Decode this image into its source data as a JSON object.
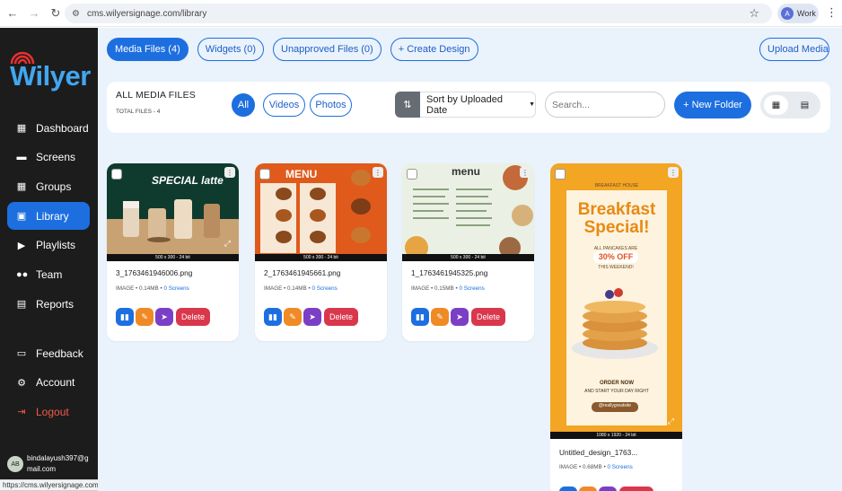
{
  "browser": {
    "url": "cms.wilyersignage.com/library",
    "profile_initial": "A",
    "profile_label": "Work",
    "status_url": "https://cms.wilyersignage.com/library"
  },
  "sidebar": {
    "brand": "Wilyer",
    "items": [
      {
        "label": "Dashboard",
        "icon": "dashboard-icon"
      },
      {
        "label": "Screens",
        "icon": "monitor-icon"
      },
      {
        "label": "Groups",
        "icon": "groups-grid-icon"
      },
      {
        "label": "Library",
        "icon": "library-folder-icon",
        "active": true
      },
      {
        "label": "Playlists",
        "icon": "playlist-icon"
      },
      {
        "label": "Team",
        "icon": "team-icon"
      },
      {
        "label": "Reports",
        "icon": "reports-icon"
      }
    ],
    "bottom_items": [
      {
        "label": "Feedback",
        "icon": "feedback-icon"
      },
      {
        "label": "Account",
        "icon": "gear-icon"
      },
      {
        "label": "Logout",
        "icon": "logout-icon"
      }
    ],
    "user": {
      "initials": "AB",
      "email": "bindalayush397@gmail.com"
    }
  },
  "tabs": {
    "media": "Media Files (4)",
    "widgets": "Widgets (0)",
    "unapproved": "Unapproved Files (0)",
    "create": "+ Create Design",
    "upload": "Upload Media"
  },
  "panel": {
    "title": "ALL MEDIA FILES",
    "total": "TOTAL FILES - 4",
    "filters": {
      "all": "All",
      "videos": "Videos",
      "photos": "Photos"
    },
    "sort_label": "Sort by Uploaded Date",
    "search_placeholder": "Search...",
    "new_folder": "+ New Folder"
  },
  "files": [
    {
      "name": "3_1763461946006.png",
      "type": "IMAGE",
      "size": "0.14MB",
      "screens": "0 Screens",
      "dims": "500 x 300 - 24 bit",
      "thumb_text": "SPECIAL latte"
    },
    {
      "name": "2_1763461945661.png",
      "type": "IMAGE",
      "size": "0.14MB",
      "screens": "0 Screens",
      "dims": "500 x 300 - 24 bit",
      "thumb_text": "MENU"
    },
    {
      "name": "1_1763461945325.png",
      "type": "IMAGE",
      "size": "0.15MB",
      "screens": "0 Screens",
      "dims": "500 x 300 - 24 bit",
      "thumb_text": "menu"
    },
    {
      "name": "Untitled_design_1763...",
      "type": "IMAGE",
      "size": "0.68MB",
      "screens": "0 Screens",
      "dims": "1080 x 1920 - 24 bit",
      "thumb_title": "Breakfast Special!",
      "thumb_badge": "30% OFF",
      "thumb_badge_top": "ALL PANCAKES ARE",
      "thumb_badge_bottom": "THIS WEEKEND!",
      "thumb_order": "ORDER NOW",
      "thumb_order_sub": "AND START YOUR DAY RIGHT",
      "thumb_handle": "@reallygreatsite",
      "thumb_brand": "BREAKFAST HOUSE"
    }
  ],
  "actions": {
    "delete": "Delete"
  },
  "colors": {
    "accent": "#1d6fe0",
    "sidebar": "#1c1c1c",
    "delete": "#d9374b",
    "logout": "#f05a4a",
    "main_bg": "#eaf2fb"
  }
}
